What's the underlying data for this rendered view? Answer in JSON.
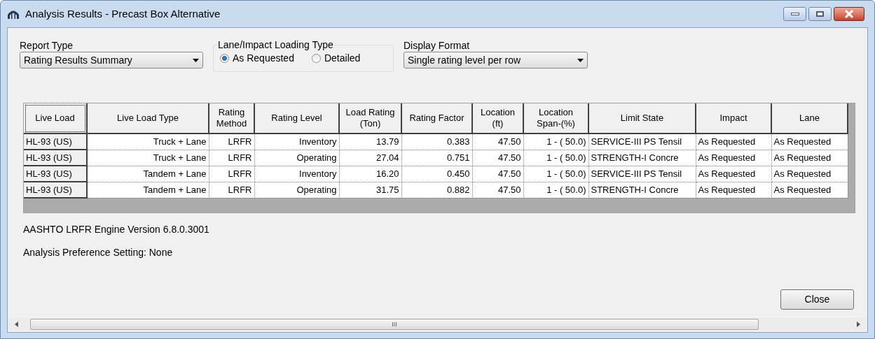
{
  "window": {
    "title": "Analysis Results - Precast Box Alternative"
  },
  "report_type": {
    "label": "Report Type",
    "value": "Rating Results Summary"
  },
  "loading_type": {
    "label": "Lane/Impact Loading Type",
    "options": [
      {
        "label": "As Requested",
        "selected": true
      },
      {
        "label": "Detailed",
        "selected": false
      }
    ]
  },
  "display_format": {
    "label": "Display Format",
    "value": "Single rating level per row"
  },
  "table": {
    "columns": [
      "Live Load",
      "Live Load Type",
      "Rating Method",
      "Rating Level",
      "Load Rating (Ton)",
      "Rating Factor",
      "Location (ft)",
      "Location Span-(%)",
      "Limit State",
      "Impact",
      "Lane"
    ],
    "rows": [
      [
        "HL-93 (US)",
        "Truck + Lane",
        "LRFR",
        "Inventory",
        "13.79",
        "0.383",
        "47.50",
        "1 - ( 50.0)",
        "SERVICE-III PS Tensil",
        "As Requested",
        "As Requested"
      ],
      [
        "HL-93 (US)",
        "Truck + Lane",
        "LRFR",
        "Operating",
        "27.04",
        "0.751",
        "47.50",
        "1 - ( 50.0)",
        "STRENGTH-I Concre",
        "As Requested",
        "As Requested"
      ],
      [
        "HL-93 (US)",
        "Tandem + Lane",
        "LRFR",
        "Inventory",
        "16.20",
        "0.450",
        "47.50",
        "1 - ( 50.0)",
        "SERVICE-III PS Tensil",
        "As Requested",
        "As Requested"
      ],
      [
        "HL-93 (US)",
        "Tandem + Lane",
        "LRFR",
        "Operating",
        "31.75",
        "0.882",
        "47.50",
        "1 - ( 50.0)",
        "STRENGTH-I Concre",
        "As Requested",
        "As Requested"
      ]
    ]
  },
  "engine_version": "AASHTO LRFR Engine Version 6.8.0.3001",
  "preference_setting": "Analysis Preference Setting: None",
  "close_button": "Close",
  "scrollbar_grip": "III"
}
